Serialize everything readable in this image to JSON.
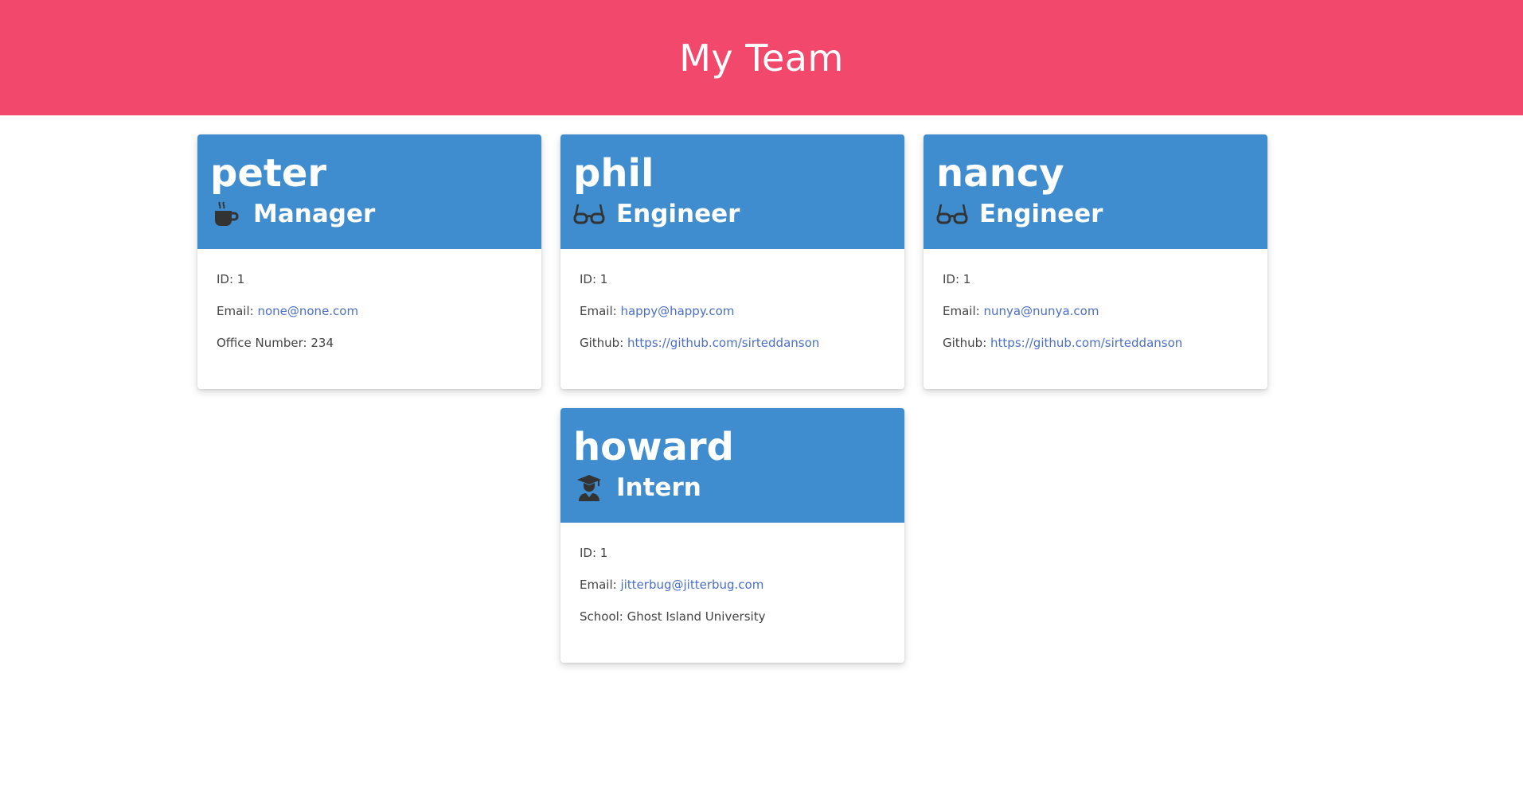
{
  "header": {
    "title": "My Team"
  },
  "team": [
    {
      "name": "peter",
      "role": "Manager",
      "icon": "coffee-icon",
      "id_label": "ID: ",
      "id": "1",
      "email_label": "Email: ",
      "email": "none@none.com",
      "extra_label": "Office Number: ",
      "extra_value": "234"
    },
    {
      "name": "phil",
      "role": "Engineer",
      "icon": "glasses-icon",
      "id_label": "ID: ",
      "id": "1",
      "email_label": "Email: ",
      "email": "happy@happy.com",
      "extra_label": "Github: ",
      "extra_value": "https://github.com/sirteddanson"
    },
    {
      "name": "nancy",
      "role": "Engineer",
      "icon": "glasses-icon",
      "id_label": "ID: ",
      "id": "1",
      "email_label": "Email: ",
      "email": "nunya@nunya.com",
      "extra_label": "Github: ",
      "extra_value": "https://github.com/sirteddanson"
    },
    {
      "name": "howard",
      "role": "Intern",
      "icon": "graduate-icon",
      "id_label": "ID: ",
      "id": "1",
      "email_label": "Email: ",
      "email": "jitterbug@jitterbug.com",
      "extra_label": "School: ",
      "extra_value": "Ghost Island University"
    }
  ],
  "colors": {
    "header_bg": "#f2486b",
    "card_header_bg": "#3f8ccf",
    "link": "#4a6fc7",
    "body_text": "#444444"
  }
}
